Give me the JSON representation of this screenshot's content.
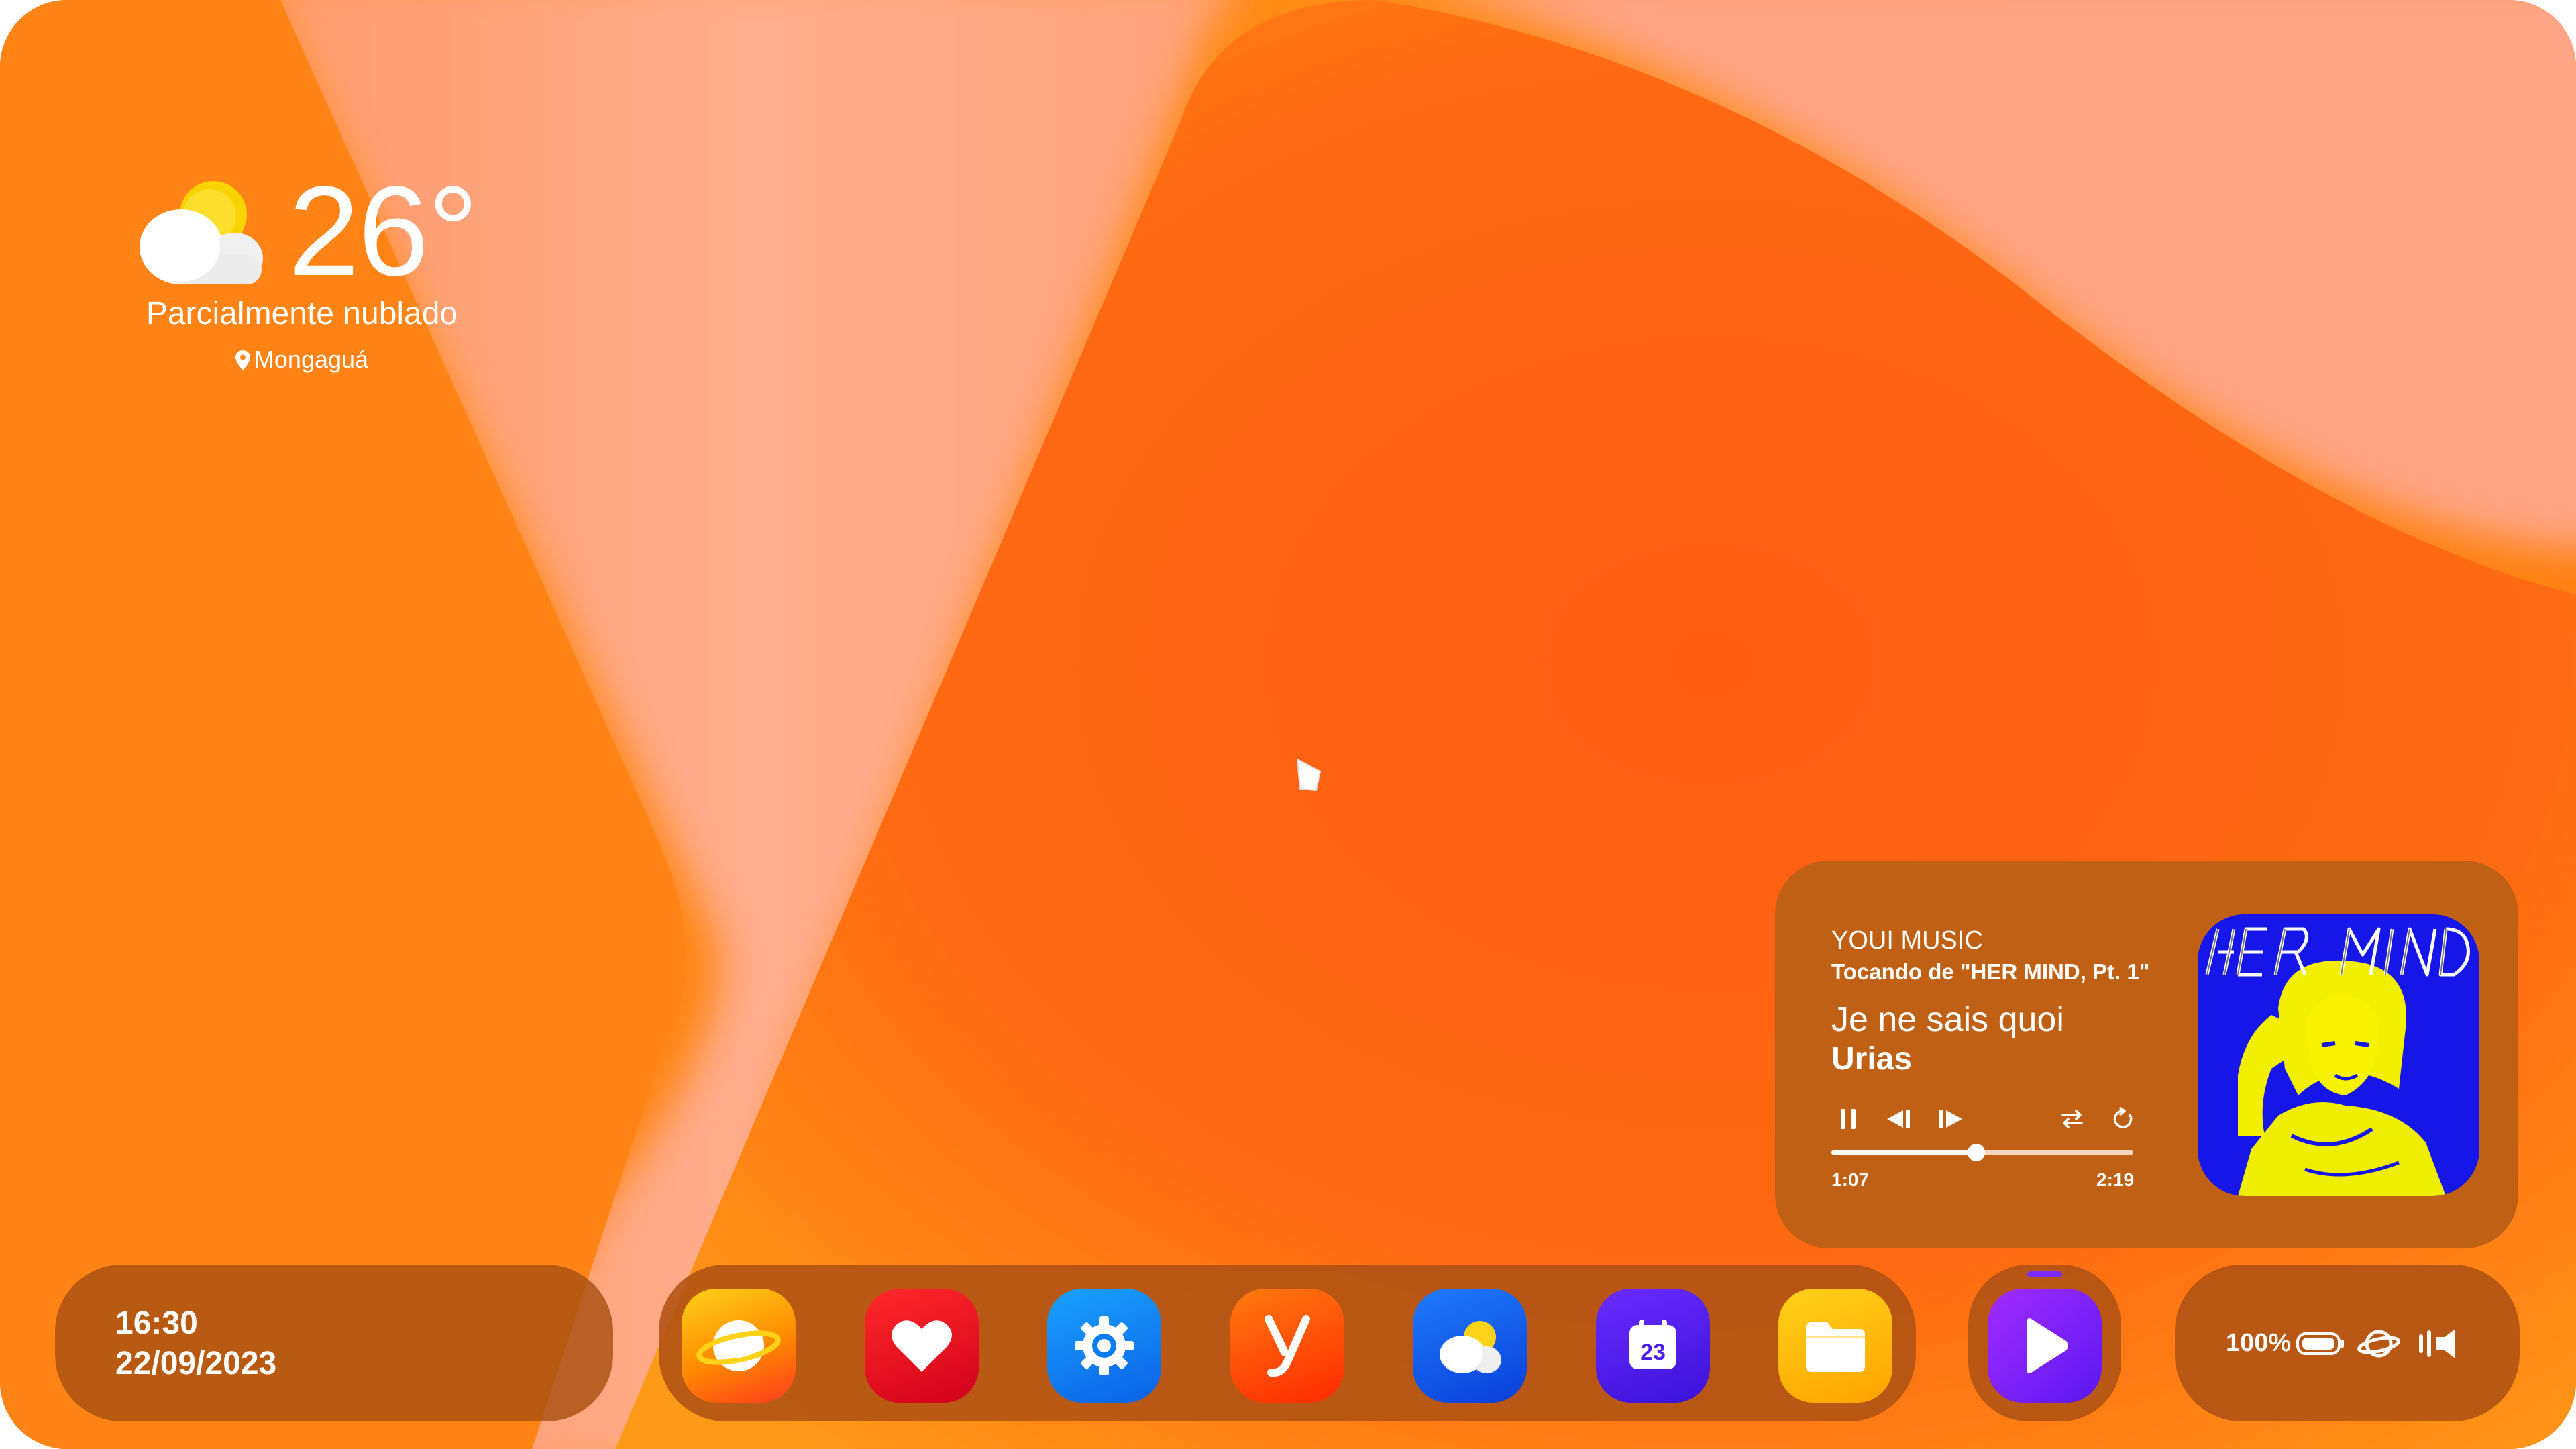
{
  "weather": {
    "temperature": "26°",
    "condition": "Parcialmente nublado",
    "location": "Mongaguá",
    "icon": "partly-cloudy-icon"
  },
  "music": {
    "app_name": "YOUI MUSIC",
    "playing_from": "Tocando de \"HER MIND, Pt. 1\"",
    "song": "Je ne sais quoi",
    "artist": "Urias",
    "elapsed": "1:07",
    "duration": "2:19",
    "progress": 0.48,
    "album_art_text": "HER MIND",
    "controls": [
      "pause-icon",
      "previous-icon",
      "next-icon",
      "repeat-icon",
      "replay-icon"
    ]
  },
  "taskbar": {
    "time": "16:30",
    "date": "22/09/2023",
    "apps": [
      {
        "name": "browser-app",
        "icon": "planet-icon"
      },
      {
        "name": "health-app",
        "icon": "heart-icon"
      },
      {
        "name": "settings-app",
        "icon": "gear-icon"
      },
      {
        "name": "y-app",
        "icon": "y-letter-icon"
      },
      {
        "name": "weather-app",
        "icon": "cloud-sun-icon"
      },
      {
        "name": "calendar-app",
        "icon": "calendar-icon",
        "label": "23"
      },
      {
        "name": "files-app",
        "icon": "folder-icon"
      }
    ],
    "active_app": {
      "name": "music-player-app",
      "icon": "play-icon"
    },
    "tray": {
      "battery_percent": "100%",
      "icons": [
        "battery-icon",
        "planet-network-icon",
        "volume-icon"
      ]
    }
  },
  "colors": {
    "primary_orange": "#ff8a14",
    "deep_orange": "#ff5f14",
    "peach": "#ffa687",
    "panel": "#c06014",
    "accent_purple": "#7b2cff"
  }
}
